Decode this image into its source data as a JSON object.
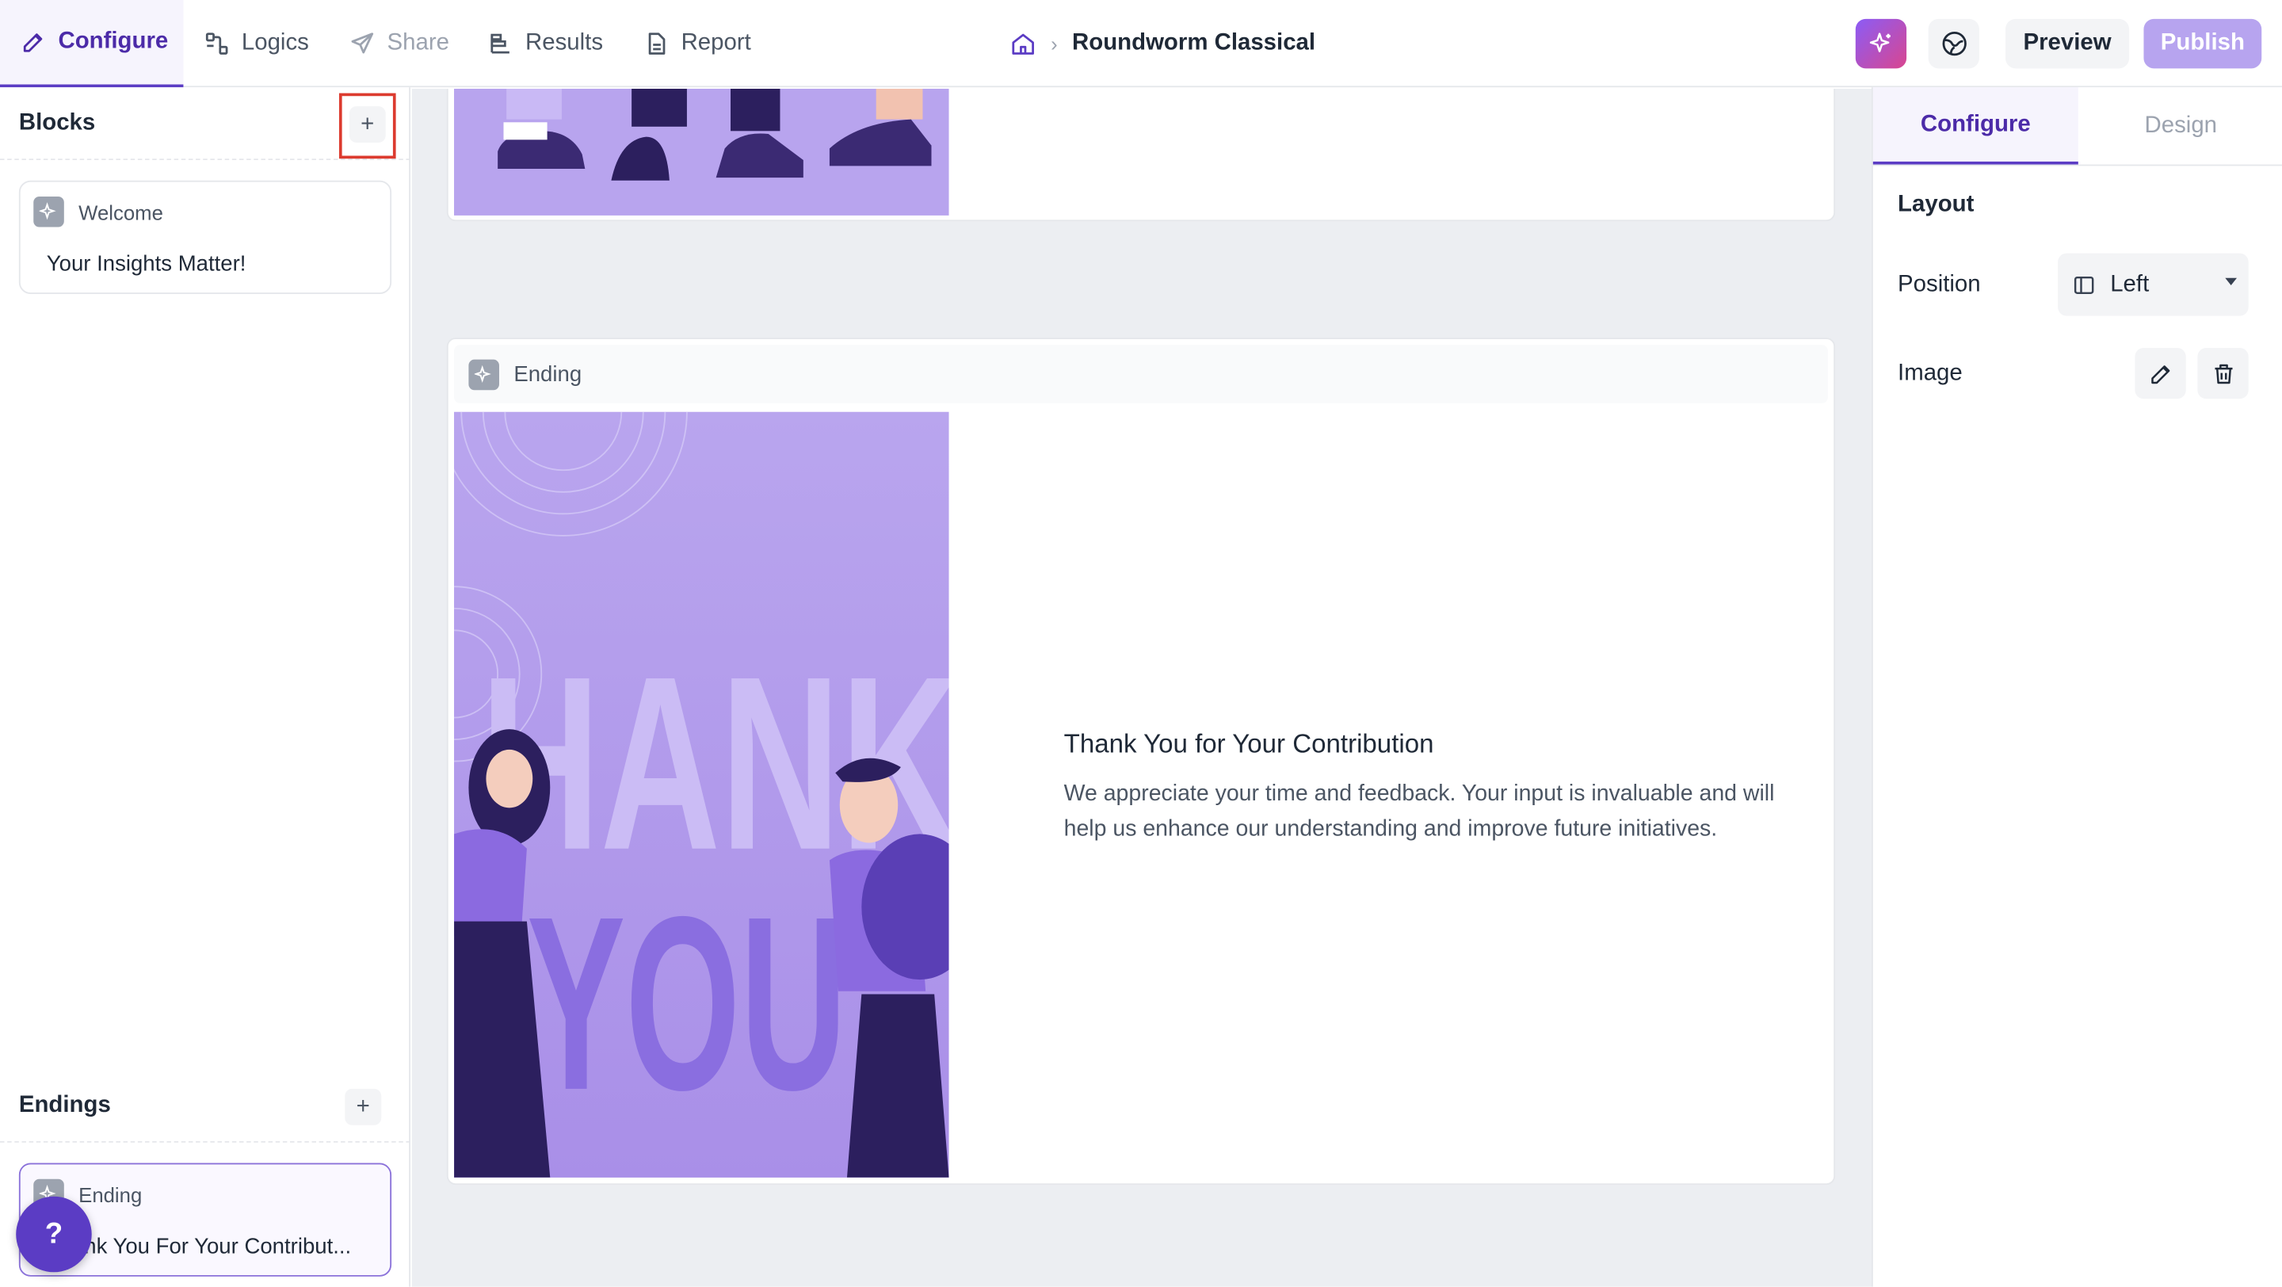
{
  "topnav": {
    "tabs": [
      {
        "label": "Configure",
        "icon": "pencil-icon",
        "state": "active"
      },
      {
        "label": "Logics",
        "icon": "logic-flow-icon",
        "state": "normal"
      },
      {
        "label": "Share",
        "icon": "paper-plane-icon",
        "state": "disabled"
      },
      {
        "label": "Results",
        "icon": "bar-chart-icon",
        "state": "normal"
      },
      {
        "label": "Report",
        "icon": "document-icon",
        "state": "normal"
      }
    ],
    "breadcrumb": {
      "home_icon": "home-icon",
      "separator": "›",
      "current": "Roundworm Classical"
    },
    "ai_icon": "sparkle-icon",
    "language_icon": "globe-icon",
    "preview_label": "Preview",
    "publish_label": "Publish"
  },
  "leftbar": {
    "blocks_title": "Blocks",
    "endings_title": "Endings",
    "add_symbol": "+",
    "blocks": [
      {
        "kind": "Welcome",
        "title": "Your Insights Matter!"
      }
    ],
    "endings": [
      {
        "kind": "Ending",
        "title": "Thank You For Your Contribut..."
      }
    ],
    "help_label": "?"
  },
  "canvas": {
    "ending_card": {
      "kind": "Ending",
      "image_text_top": "HANK",
      "image_text_bottom": "YOU",
      "title": "Thank You for Your Contribution",
      "description": "We appreciate your time and feedback. Your input is invaluable and will help us enhance our understanding and improve future initiatives."
    }
  },
  "rightbar": {
    "tabs": [
      {
        "label": "Configure",
        "state": "active"
      },
      {
        "label": "Design",
        "state": "normal"
      }
    ],
    "layout_label": "Layout",
    "position_label": "Position",
    "position_value": "Left",
    "image_label": "Image"
  },
  "colors": {
    "accent": "#5b3cc4",
    "publish_bg": "#b7a4ef",
    "illustration_bg": "#b8a4ee",
    "highlight_red": "#dc3b2f"
  }
}
